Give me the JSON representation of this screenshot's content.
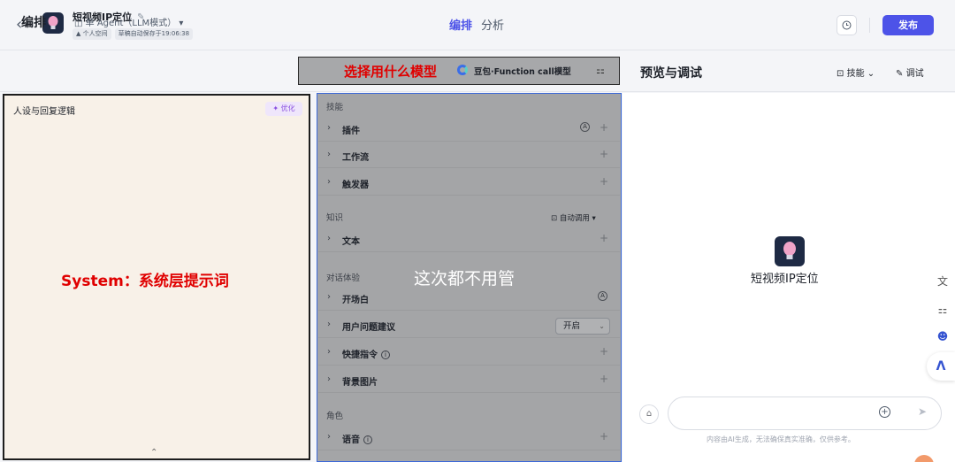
{
  "topbar": {
    "back_icon": "chevron-left-icon",
    "bot_name": "短视频IP定位",
    "meta_space": "个人空间",
    "meta_draft": "草稿自动保存于19:06:38",
    "tabs": [
      {
        "label": "编排",
        "active": true
      },
      {
        "label": "分析",
        "active": false
      }
    ],
    "publish_label": "发布",
    "accent": "#4d53e8"
  },
  "header": {
    "edit_label": "编排",
    "agent_mode": "单 Agent（LLM模式）",
    "model_annotation": "选择用什么模型",
    "model_name": "豆包·Function call模型",
    "preview_label": "预览与调试",
    "skill_label": "技能",
    "debug_label": "调试"
  },
  "left": {
    "title": "人设与回复逻辑",
    "optimize_label": "优化",
    "annotation": "System：系统层提示词"
  },
  "middle": {
    "annotation": "这次都不用管",
    "sections": {
      "skills": "技能",
      "knowledge": "知识",
      "dialog": "对话体验",
      "role": "角色"
    },
    "auto_call": "自动调用",
    "rows": {
      "plugin": "插件",
      "workflow": "工作流",
      "trigger": "触发器",
      "text": "文本",
      "opening": "开场白",
      "suggestion": "用户问题建议",
      "shortcut": "快捷指令",
      "background": "背景图片",
      "voice": "语音"
    },
    "suggestion_value": "开启"
  },
  "right": {
    "bot_name": "短视频IP定位",
    "disclaimer": "内容由AI生成，无法确保真实准确，仅供参考。",
    "input_placeholder": ""
  }
}
